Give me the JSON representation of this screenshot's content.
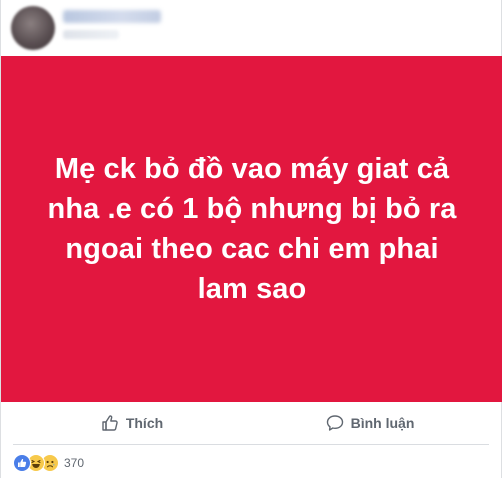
{
  "post": {
    "text": "Mẹ ck bỏ đồ vao máy giat cả\nnha .e có 1 bộ nhưng bị bỏ ra\nngoai theo cac chi em phai\nlam sao",
    "background_color": "#e2173f",
    "text_color": "#ffffff"
  },
  "actions": {
    "like_label": "Thích",
    "comment_label": "Bình luận"
  },
  "reactions": {
    "types": [
      "like-icon",
      "haha-icon",
      "sad-icon"
    ],
    "count": "370"
  },
  "colors": {
    "action_text": "#606770",
    "like_blue": "#4a7ee8",
    "emoji_yellow": "#f7c94b"
  }
}
